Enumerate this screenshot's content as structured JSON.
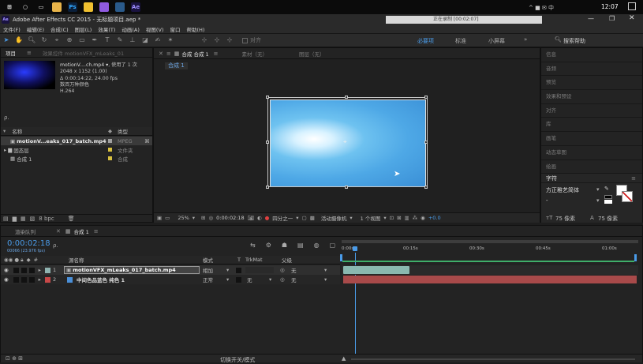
{
  "taskbar": {
    "time": "12:07",
    "tray": "^ ■ ✉ 中"
  },
  "window": {
    "title": "Adobe After Effects CC 2015 - 无标题项目.aep *",
    "recording": "正在录制 [00:02:07]"
  },
  "menu": [
    "文件(F)",
    "编辑(E)",
    "合成(C)",
    "图层(L)",
    "效果(T)",
    "动画(A)",
    "视图(V)",
    "窗口",
    "帮助(H)"
  ],
  "toolbar": {
    "snap_label": "对齐",
    "workspaces": [
      "必要项",
      "标准",
      "小屏幕"
    ],
    "search": "搜索帮助"
  },
  "project": {
    "tab_label": "项目",
    "effects_tab": "效果控件 motionVFX_mLeaks_01",
    "file_name": "motionV....ch.mp4 ▾",
    "used": ", 使用了 1 次",
    "size": "2048 x 1152 (1.00)",
    "duration": "Δ 0:00:14:22, 24.00 fps",
    "colors": "数百万种颜色",
    "codec": "H.264",
    "search_placeholder": "ρ.",
    "col_name": "名称",
    "col_type": "类型",
    "items": [
      {
        "name": "motionV...eaks_017_batch.mp4",
        "type": "MPEG"
      },
      {
        "name": "固态层",
        "type": "文件夹"
      },
      {
        "name": "合成 1",
        "type": "合成"
      }
    ],
    "bpc": "8 bpc"
  },
  "viewer": {
    "tabs": [
      "合成 合成 1",
      "素材（无）",
      "图层（无）"
    ],
    "comp_label": "合成 1",
    "zoom": "25%",
    "timecode": "0:00:02:18",
    "resolution": "四分之一",
    "camera": "活动摄像机",
    "views": "1 个视图",
    "exposure": "+0.0"
  },
  "right_panel": {
    "items": [
      "信息",
      "音频",
      "预览",
      "效果和预设",
      "对齐",
      "库",
      "画笔",
      "动态草图",
      "绘画"
    ],
    "char_title": "字符",
    "font": "方正稚艺简体",
    "style": "-",
    "size": "75 像素",
    "leading": "75 像素"
  },
  "timeline": {
    "tabs": [
      "渲染队列",
      "合成 1"
    ],
    "timecode": "0:00:02:18",
    "frame_info": "00066 (23.976 fps)",
    "search_placeholder": "ρ.",
    "col_layer": "源名称",
    "col_mode": "模式",
    "col_t": "T",
    "col_trk": "TrkMat",
    "col_parent": "父级",
    "layers": [
      {
        "num": "1",
        "name": "motionVFX_mLeaks_017_batch.mp4",
        "mode": "相加",
        "trk": "",
        "parent": "无",
        "color": "#8fb3b0"
      },
      {
        "num": "2",
        "name": "中间色品蓝色 纯色 1",
        "mode": "正常",
        "trk": "无",
        "parent": "无",
        "color": "#c84848"
      }
    ],
    "ruler": [
      "0:00s",
      "00:15s",
      "00:30s",
      "00:45s",
      "01:00s"
    ],
    "footer": "切换开关/模式"
  },
  "colors": {
    "accent": "#2d8ceb",
    "bg": "#1d1d1d",
    "panel": "#232323",
    "layer1_bar": "#8ab8b0",
    "layer2_bar": "#a84a4a"
  }
}
